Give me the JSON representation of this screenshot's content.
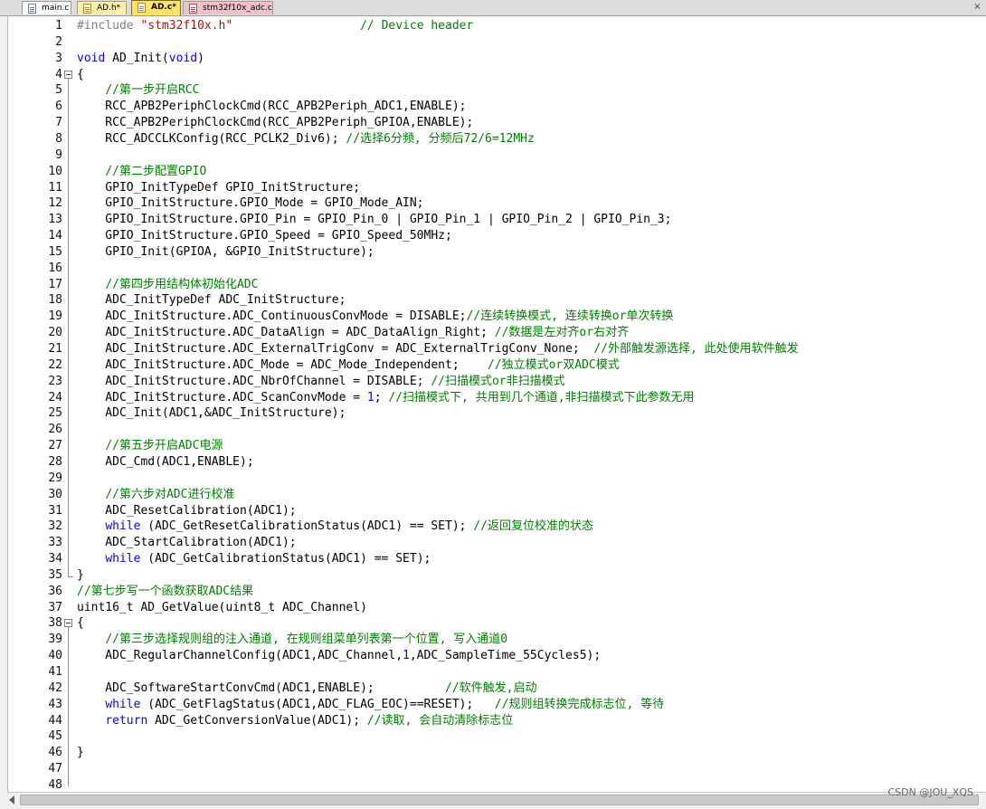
{
  "tabs": [
    {
      "label": "main.c"
    },
    {
      "label": "AD.h*"
    },
    {
      "label": "AD.c*"
    },
    {
      "label": "stm32f10x_adc.c"
    }
  ],
  "close_label": "×",
  "lines": [
    [
      {
        "t": "#include ",
        "c": "pp"
      },
      {
        "t": "\"stm32f10x.h\"",
        "c": "st"
      },
      {
        "t": "                  "
      },
      {
        "t": "// Device header",
        "c": "cm"
      }
    ],
    [],
    [
      {
        "t": "void",
        "c": "kw"
      },
      {
        "t": " AD_Init("
      },
      {
        "t": "void",
        "c": "kw"
      },
      {
        "t": ")"
      }
    ],
    [
      {
        "t": "{"
      }
    ],
    [
      {
        "t": "    "
      },
      {
        "t": "//第一步开启RCC",
        "c": "cm"
      }
    ],
    [
      {
        "t": "    RCC_APB2PeriphClockCmd(RCC_APB2Periph_ADC1,ENABLE);"
      }
    ],
    [
      {
        "t": "    RCC_APB2PeriphClockCmd(RCC_APB2Periph_GPIOA,ENABLE);"
      }
    ],
    [
      {
        "t": "    RCC_ADCCLKConfig(RCC_PCLK2_Div6); "
      },
      {
        "t": "//选择6分频, 分频后72/6=12MHz",
        "c": "cm"
      }
    ],
    [],
    [
      {
        "t": "    "
      },
      {
        "t": "//第二步配置GPIO",
        "c": "cm"
      }
    ],
    [
      {
        "t": "    GPIO_InitTypeDef GPIO_InitStructure;"
      }
    ],
    [
      {
        "t": "    GPIO_InitStructure.GPIO_Mode = GPIO_Mode_AIN;"
      }
    ],
    [
      {
        "t": "    GPIO_InitStructure.GPIO_Pin = GPIO_Pin_0 | GPIO_Pin_1 | GPIO_Pin_2 | GPIO_Pin_3;"
      }
    ],
    [
      {
        "t": "    GPIO_InitStructure.GPIO_Speed = GPIO_Speed_50MHz;"
      }
    ],
    [
      {
        "t": "    GPIO_Init(GPIOA, &GPIO_InitStructure);"
      }
    ],
    [],
    [
      {
        "t": "    "
      },
      {
        "t": "//第四步用结构体初始化ADC",
        "c": "cm"
      }
    ],
    [
      {
        "t": "    ADC_InitTypeDef ADC_InitStructure;"
      }
    ],
    [
      {
        "t": "    ADC_InitStructure.ADC_ContinuousConvMode = DISABLE;"
      },
      {
        "t": "//连续转换模式, 连续转换or单次转换",
        "c": "cm"
      }
    ],
    [
      {
        "t": "    ADC_InitStructure.ADC_DataAlign = ADC_DataAlign_Right; "
      },
      {
        "t": "//数据是左对齐or右对齐",
        "c": "cm"
      }
    ],
    [
      {
        "t": "    ADC_InitStructure.ADC_ExternalTrigConv = ADC_ExternalTrigConv_None;  "
      },
      {
        "t": "//外部触发源选择, 此处使用软件触发",
        "c": "cm"
      }
    ],
    [
      {
        "t": "    ADC_InitStructure.ADC_Mode = ADC_Mode_Independent;    "
      },
      {
        "t": "//独立模式or双ADC模式",
        "c": "cm"
      }
    ],
    [
      {
        "t": "    ADC_InitStructure.ADC_NbrOfChannel = DISABLE; "
      },
      {
        "t": "//扫描模式or非扫描模式",
        "c": "cm"
      }
    ],
    [
      {
        "t": "    ADC_InitStructure.ADC_ScanConvMode = "
      },
      {
        "t": "1",
        "c": "nm"
      },
      {
        "t": "; "
      },
      {
        "t": "//扫描模式下, 共用到几个通道,非扫描模式下此参数无用",
        "c": "cm"
      }
    ],
    [
      {
        "t": "    ADC_Init(ADC1,&ADC_InitStructure);"
      }
    ],
    [],
    [
      {
        "t": "    "
      },
      {
        "t": "//第五步开启ADC电源",
        "c": "cm"
      }
    ],
    [
      {
        "t": "    ADC_Cmd(ADC1,ENABLE);"
      }
    ],
    [],
    [
      {
        "t": "    "
      },
      {
        "t": "//第六步对ADC进行校准",
        "c": "cm"
      }
    ],
    [
      {
        "t": "    ADC_ResetCalibration(ADC1);"
      }
    ],
    [
      {
        "t": "    "
      },
      {
        "t": "while",
        "c": "kw"
      },
      {
        "t": " (ADC_GetResetCalibrationStatus(ADC1) == SET); "
      },
      {
        "t": "//返回复位校准的状态",
        "c": "cm"
      }
    ],
    [
      {
        "t": "    ADC_StartCalibration(ADC1);"
      }
    ],
    [
      {
        "t": "    "
      },
      {
        "t": "while",
        "c": "kw"
      },
      {
        "t": " (ADC_GetCalibrationStatus(ADC1) == SET);"
      }
    ],
    [
      {
        "t": "}"
      }
    ],
    [
      {
        "t": "//第七步写一个函数获取ADC结果",
        "c": "cm"
      }
    ],
    [
      {
        "t": "uint16_t AD_GetValue(uint8_t ADC_Channel)"
      }
    ],
    [
      {
        "t": "{"
      }
    ],
    [
      {
        "t": "    "
      },
      {
        "t": "//第三步选择规则组的注入通道, 在规则组菜单列表第一个位置, 写入通道0",
        "c": "cm"
      }
    ],
    [
      {
        "t": "    ADC_RegularChannelConfig(ADC1,ADC_Channel,"
      },
      {
        "t": "1",
        "c": "nm"
      },
      {
        "t": ",ADC_SampleTime_55Cycles5);"
      }
    ],
    [],
    [
      {
        "t": "    ADC_SoftwareStartConvCmd(ADC1,ENABLE);          "
      },
      {
        "t": "//软件触发,启动",
        "c": "cm"
      }
    ],
    [
      {
        "t": "    "
      },
      {
        "t": "while",
        "c": "kw"
      },
      {
        "t": " (ADC_GetFlagStatus(ADC1,ADC_FLAG_EOC)==RESET);   "
      },
      {
        "t": "//规则组转换完成标志位, 等待",
        "c": "cm"
      }
    ],
    [
      {
        "t": "    "
      },
      {
        "t": "return",
        "c": "kw"
      },
      {
        "t": " ADC_GetConversionValue(ADC1); "
      },
      {
        "t": "//读取, 会自动清除标志位",
        "c": "cm"
      }
    ],
    [],
    [
      {
        "t": "}"
      }
    ],
    [],
    []
  ],
  "fold_markers": [
    {
      "line": 4,
      "type": "open"
    },
    {
      "line": 35,
      "type": "end"
    },
    {
      "line": 38,
      "type": "open"
    }
  ],
  "watermark": "CSDN @JOU_XQS"
}
